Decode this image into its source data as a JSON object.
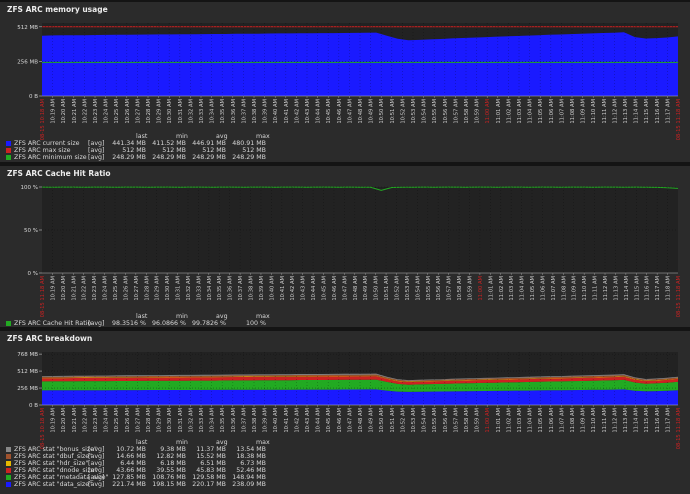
{
  "panels": [
    {
      "title": "ZFS ARC memory usage",
      "legend": {
        "headers": [
          "last",
          "min",
          "avg",
          "max"
        ],
        "rows": [
          {
            "name": "ZFS ARC current size",
            "func": "[avg]",
            "last": "441.34 MB",
            "min": "411.52 MB",
            "avg": "446.91 MB",
            "max": "480.91 MB",
            "color": "#1a1aff"
          },
          {
            "name": "ZFS ARC max size",
            "func": "[avg]",
            "last": "512 MB",
            "min": "512 MB",
            "avg": "512 MB",
            "max": "512 MB",
            "color": "#cc2222"
          },
          {
            "name": "ZFS ARC minimum size",
            "func": "[avg]",
            "last": "248.29 MB",
            "min": "248.29 MB",
            "avg": "248.29 MB",
            "max": "248.29 MB",
            "color": "#22aa22"
          }
        ]
      }
    },
    {
      "title": "ZFS ARC Cache Hit Ratio",
      "legend": {
        "headers": [
          "last",
          "min",
          "avg",
          "max"
        ],
        "rows": [
          {
            "name": "ZFS ARC Cache Hit Ratio",
            "func": "[avg]",
            "last": "98.3516 %",
            "min": "96.0866 %",
            "avg": "99.7826 %",
            "max": "100 %",
            "color": "#22aa22"
          }
        ]
      }
    },
    {
      "title": "ZFS ARC breakdown",
      "legend": {
        "headers": [
          "last",
          "min",
          "avg",
          "max"
        ],
        "rows": [
          {
            "name": "ZFS ARC stat \"bonus_size\"",
            "func": "[avg]",
            "last": "10.72 MB",
            "min": "9.38 MB",
            "avg": "11.37 MB",
            "max": "13.54 MB",
            "color": "#888888"
          },
          {
            "name": "ZFS ARC stat \"dbuf_size\"",
            "func": "[avg]",
            "last": "14.66 MB",
            "min": "12.82 MB",
            "avg": "15.52 MB",
            "max": "18.38 MB",
            "color": "#a0522d"
          },
          {
            "name": "ZFS ARC stat \"hdr_size\"",
            "func": "[avg]",
            "last": "6.44 MB",
            "min": "6.18 MB",
            "avg": "6.51 MB",
            "max": "6.73 MB",
            "color": "#e6b800"
          },
          {
            "name": "ZFS ARC stat \"dnode_size\"",
            "func": "[avg]",
            "last": "43.66 MB",
            "min": "39.55 MB",
            "avg": "45.83 MB",
            "max": "52.46 MB",
            "color": "#cc2222"
          },
          {
            "name": "ZFS ARC stat \"metadata_size\"",
            "func": "[avg]",
            "last": "127.85 MB",
            "min": "108.76 MB",
            "avg": "129.58 MB",
            "max": "148.94 MB",
            "color": "#22aa22"
          },
          {
            "name": "ZFS ARC stat \"data_size\"",
            "func": "[avg]",
            "last": "221.74 MB",
            "min": "198.15 MB",
            "avg": "220.17 MB",
            "max": "238.09 MB",
            "color": "#1a1aff"
          }
        ]
      }
    }
  ],
  "chart_data": [
    {
      "type": "area",
      "title": "ZFS ARC memory usage",
      "y_ticks": [
        "0 B",
        "256 MB",
        "512 MB"
      ],
      "ylim": [
        0,
        540
      ],
      "x_date_start": "08-15 10:18 AM",
      "x_date_end": "08-15 11:18 AM",
      "x_ticks": [
        "10:19 AM",
        "10:20 AM",
        "10:21 AM",
        "10:22 AM",
        "10:23 AM",
        "10:24 AM",
        "10:25 AM",
        "10:26 AM",
        "10:27 AM",
        "10:28 AM",
        "10:29 AM",
        "10:30 AM",
        "10:31 AM",
        "10:32 AM",
        "10:33 AM",
        "10:34 AM",
        "10:35 AM",
        "10:36 AM",
        "10:37 AM",
        "10:38 AM",
        "10:39 AM",
        "10:40 AM",
        "10:41 AM",
        "10:42 AM",
        "10:43 AM",
        "10:44 AM",
        "10:45 AM",
        "10:46 AM",
        "10:47 AM",
        "10:48 AM",
        "10:49 AM",
        "10:50 AM",
        "10:51 AM",
        "10:52 AM",
        "10:53 AM",
        "10:54 AM",
        "10:55 AM",
        "10:56 AM",
        "10:57 AM",
        "10:58 AM",
        "10:59 AM",
        "11:00 AM",
        "11:01 AM",
        "11:02 AM",
        "11:03 AM",
        "11:04 AM",
        "11:05 AM",
        "11:06 AM",
        "11:07 AM",
        "11:08 AM",
        "11:09 AM",
        "11:10 AM",
        "11:11 AM",
        "11:12 AM",
        "11:13 AM",
        "11:14 AM",
        "11:15 AM",
        "11:16 AM",
        "11:17 AM"
      ],
      "x_tick_highlight": "11:00 AM",
      "series": [
        {
          "name": "ZFS ARC current size",
          "kind": "area",
          "color": "#1a1aff",
          "values": [
            446,
            448,
            449,
            450,
            450,
            451,
            452,
            453,
            453,
            454,
            455,
            456,
            456,
            457,
            457,
            458,
            459,
            459,
            460,
            461,
            461,
            462,
            463,
            463,
            464,
            464,
            465,
            465,
            466,
            467,
            468,
            469,
            446,
            424,
            412,
            415,
            419,
            422,
            426,
            429,
            432,
            435,
            438,
            441,
            444,
            447,
            450,
            453,
            455,
            458,
            461,
            463,
            466,
            468,
            472,
            436,
            425,
            428,
            433,
            441
          ]
        },
        {
          "name": "ZFS ARC max size",
          "kind": "line",
          "color": "#cc2222",
          "values": [
            512,
            512
          ]
        },
        {
          "name": "ZFS ARC minimum size",
          "kind": "line",
          "color": "#22aa22",
          "values": [
            248.29,
            248.29
          ]
        }
      ]
    },
    {
      "type": "line",
      "title": "ZFS ARC Cache Hit Ratio",
      "y_ticks": [
        "0 %",
        "50 %",
        "100 %"
      ],
      "ylim": [
        0,
        100
      ],
      "x_date_start": "08-15 11:18 AM",
      "x_date_end": "08-15 11:18 AM",
      "x_ticks": [
        "10:19 AM",
        "10:20 AM",
        "10:21 AM",
        "10:22 AM",
        "10:23 AM",
        "10:24 AM",
        "10:25 AM",
        "10:26 AM",
        "10:27 AM",
        "10:28 AM",
        "10:29 AM",
        "10:30 AM",
        "10:31 AM",
        "10:32 AM",
        "10:33 AM",
        "10:34 AM",
        "10:35 AM",
        "10:36 AM",
        "10:37 AM",
        "10:38 AM",
        "10:39 AM",
        "10:40 AM",
        "10:41 AM",
        "10:42 AM",
        "10:43 AM",
        "10:44 AM",
        "10:45 AM",
        "10:46 AM",
        "10:47 AM",
        "10:48 AM",
        "10:49 AM",
        "10:50 AM",
        "10:51 AM",
        "10:52 AM",
        "10:53 AM",
        "10:54 AM",
        "10:55 AM",
        "10:56 AM",
        "10:57 AM",
        "10:58 AM",
        "10:59 AM",
        "11:00 AM",
        "11:01 AM",
        "11:02 AM",
        "11:03 AM",
        "11:04 AM",
        "11:05 AM",
        "11:06 AM",
        "11:07 AM",
        "11:08 AM",
        "11:09 AM",
        "11:10 AM",
        "11:11 AM",
        "11:12 AM",
        "11:13 AM",
        "11:14 AM",
        "11:15 AM",
        "11:16 AM",
        "11:17 AM",
        "11:18 AM"
      ],
      "x_tick_highlight": "11:00 AM",
      "series": [
        {
          "name": "ZFS ARC Cache Hit Ratio",
          "kind": "line",
          "color": "#22aa22",
          "values": [
            99.9,
            99.8,
            99.9,
            99.9,
            99.8,
            99.9,
            99.9,
            99.8,
            99.9,
            99.9,
            99.8,
            99.9,
            99.9,
            99.8,
            99.9,
            99.9,
            99.8,
            99.9,
            99.9,
            99.8,
            99.9,
            99.9,
            99.8,
            99.9,
            99.9,
            99.8,
            99.9,
            99.9,
            99.8,
            99.9,
            99.8,
            99.7,
            96.1,
            99.4,
            99.7,
            99.8,
            99.9,
            99.8,
            99.9,
            99.9,
            99.8,
            99.9,
            99.9,
            99.8,
            99.9,
            99.9,
            99.8,
            99.9,
            99.9,
            99.8,
            99.9,
            99.9,
            99.8,
            99.9,
            99.9,
            99.8,
            99.9,
            99.7,
            99.5,
            99.2,
            98.4
          ]
        }
      ]
    },
    {
      "type": "area",
      "title": "ZFS ARC breakdown",
      "y_ticks": [
        "0 B",
        "256 MB",
        "512 MB",
        "768 MB"
      ],
      "ylim": [
        0,
        800
      ],
      "x_date_start": "08-15 10:18 AM",
      "x_date_end": "08-15 11:18 AM",
      "x_ticks": [
        "10:19 AM",
        "10:20 AM",
        "10:21 AM",
        "10:22 AM",
        "10:23 AM",
        "10:24 AM",
        "10:25 AM",
        "10:26 AM",
        "10:27 AM",
        "10:28 AM",
        "10:29 AM",
        "10:30 AM",
        "10:31 AM",
        "10:32 AM",
        "10:33 AM",
        "10:34 AM",
        "10:35 AM",
        "10:36 AM",
        "10:37 AM",
        "10:38 AM",
        "10:39 AM",
        "10:40 AM",
        "10:41 AM",
        "10:42 AM",
        "10:43 AM",
        "10:44 AM",
        "10:45 AM",
        "10:46 AM",
        "10:47 AM",
        "10:48 AM",
        "10:49 AM",
        "10:50 AM",
        "10:51 AM",
        "10:52 AM",
        "10:53 AM",
        "10:54 AM",
        "10:55 AM",
        "10:56 AM",
        "10:57 AM",
        "10:58 AM",
        "10:59 AM",
        "11:00 AM",
        "11:01 AM",
        "11:02 AM",
        "11:03 AM",
        "11:04 AM",
        "11:05 AM",
        "11:06 AM",
        "11:07 AM",
        "11:08 AM",
        "11:09 AM",
        "11:10 AM",
        "11:11 AM",
        "11:12 AM",
        "11:13 AM",
        "11:14 AM",
        "11:15 AM",
        "11:16 AM",
        "11:17 AM"
      ],
      "x_tick_highlight": "11:00 AM",
      "stacked": true,
      "series": [
        {
          "name": "ZFS ARC stat \"data_size\"",
          "color": "#1a1aff",
          "values": [
            221,
            222,
            222,
            223,
            223,
            224,
            224,
            225,
            225,
            225,
            226,
            226,
            227,
            227,
            227,
            228,
            228,
            229,
            229,
            229,
            230,
            230,
            231,
            231,
            232,
            232,
            233,
            233,
            234,
            234,
            235,
            236,
            218,
            203,
            198,
            200,
            202,
            204,
            206,
            208,
            210,
            212,
            213,
            215,
            217,
            218,
            220,
            222,
            223,
            225,
            227,
            229,
            231,
            233,
            236,
            215,
            207,
            210,
            215,
            222
          ]
        },
        {
          "name": "ZFS ARC stat \"metadata_size\"",
          "color": "#22aa22",
          "values": [
            135,
            135,
            136,
            136,
            137,
            137,
            137,
            138,
            138,
            139,
            139,
            139,
            140,
            140,
            141,
            141,
            141,
            142,
            142,
            143,
            143,
            143,
            144,
            144,
            145,
            145,
            145,
            146,
            146,
            147,
            147,
            148,
            130,
            115,
            109,
            111,
            113,
            115,
            117,
            119,
            121,
            122,
            124,
            126,
            127,
            129,
            130,
            132,
            133,
            135,
            136,
            138,
            139,
            141,
            143,
            125,
            114,
            117,
            121,
            128
          ]
        },
        {
          "name": "ZFS ARC stat \"dnode_size\"",
          "color": "#cc2222",
          "values": [
            47,
            47,
            47,
            48,
            48,
            48,
            48,
            48,
            49,
            49,
            49,
            49,
            49,
            50,
            50,
            50,
            50,
            50,
            51,
            51,
            51,
            51,
            51,
            52,
            52,
            52,
            52,
            52,
            52,
            52,
            52,
            52,
            46,
            41,
            40,
            40,
            41,
            41,
            42,
            42,
            42,
            43,
            43,
            43,
            44,
            44,
            45,
            45,
            45,
            46,
            46,
            46,
            47,
            47,
            48,
            44,
            41,
            42,
            43,
            44
          ]
        },
        {
          "name": "ZFS ARC stat \"hdr_size\"",
          "color": "#e6b800",
          "values": [
            6.5,
            6.5,
            6.5,
            6.5,
            6.5,
            6.5,
            6.5,
            6.6,
            6.6,
            6.6,
            6.6,
            6.6,
            6.6,
            6.6,
            6.6,
            6.6,
            6.7,
            6.7,
            6.7,
            6.7,
            6.7,
            6.7,
            6.7,
            6.7,
            6.7,
            6.7,
            6.7,
            6.7,
            6.7,
            6.7,
            6.7,
            6.7,
            6.4,
            6.2,
            6.2,
            6.2,
            6.2,
            6.3,
            6.3,
            6.3,
            6.3,
            6.3,
            6.4,
            6.4,
            6.4,
            6.4,
            6.4,
            6.5,
            6.5,
            6.5,
            6.5,
            6.5,
            6.5,
            6.6,
            6.6,
            6.4,
            6.3,
            6.3,
            6.4,
            6.4
          ]
        },
        {
          "name": "ZFS ARC stat \"dbuf_size\"",
          "color": "#a0522d",
          "values": [
            15.8,
            15.9,
            16,
            16.1,
            16.2,
            16.3,
            16.4,
            16.5,
            16.6,
            16.7,
            16.8,
            16.9,
            17,
            17.1,
            17.2,
            17.3,
            17.4,
            17.5,
            17.6,
            17.7,
            17.8,
            17.9,
            18,
            18.1,
            18.2,
            18.2,
            18.3,
            18.3,
            18.3,
            18.4,
            18.4,
            18.4,
            15,
            13.2,
            12.8,
            13,
            13.3,
            13.6,
            13.9,
            14.2,
            14.5,
            14.8,
            15.1,
            15.4,
            15.7,
            16,
            16.3,
            16.6,
            16.9,
            17.2,
            17.5,
            17.7,
            17.9,
            18.1,
            18.3,
            15.5,
            13.9,
            14.2,
            14.4,
            14.7
          ]
        },
        {
          "name": "ZFS ARC stat \"bonus_size\"",
          "color": "#888888",
          "values": [
            11.6,
            11.7,
            11.8,
            11.9,
            12,
            12.1,
            12.2,
            12.3,
            12.4,
            12.5,
            12.6,
            12.7,
            12.8,
            12.9,
            13,
            13.1,
            13.2,
            13.3,
            13.4,
            13.4,
            13.5,
            13.5,
            13.5,
            13.5,
            13.5,
            13.5,
            13.5,
            13.5,
            13.5,
            13.5,
            13.5,
            13.5,
            11,
            9.7,
            9.4,
            9.6,
            9.8,
            10,
            10.2,
            10.4,
            10.6,
            10.8,
            11,
            11.2,
            11.4,
            11.6,
            11.8,
            12,
            12.2,
            12.4,
            12.6,
            12.8,
            13,
            13.2,
            13.4,
            11.3,
            10.1,
            10.3,
            10.5,
            10.7
          ]
        }
      ]
    }
  ]
}
